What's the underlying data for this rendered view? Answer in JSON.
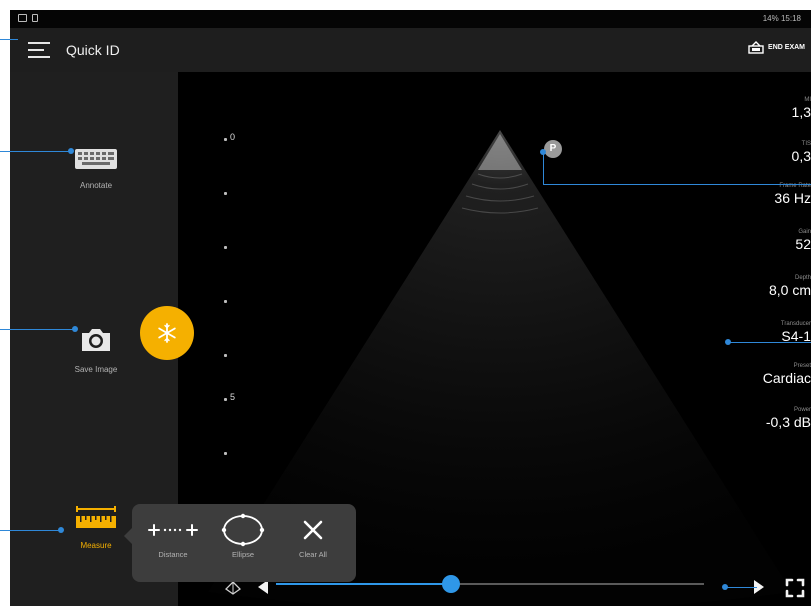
{
  "status_bar": {
    "right_text": "14% 15:18"
  },
  "app_bar": {
    "title": "Quick ID",
    "end_exam_label": "END EXAM"
  },
  "sidebar": {
    "annotate_label": "Annotate",
    "save_image_label": "Save Image",
    "measure_label": "Measure"
  },
  "depth_scale": {
    "top_label": "0",
    "mid_label": "5"
  },
  "marker": {
    "orientation_label": "P"
  },
  "parameters": [
    {
      "key": "MI",
      "value": "1,3"
    },
    {
      "key": "TIS",
      "value": "0,3"
    },
    {
      "key": "Frame Rate",
      "value": "36 Hz"
    },
    {
      "key": "Gain",
      "value": "52"
    },
    {
      "key": "Depth",
      "value": "8,0 cm"
    },
    {
      "key": "Transducer",
      "value": "S4-1"
    },
    {
      "key": "Preset",
      "value": "Cardiac"
    },
    {
      "key": "Power",
      "value": "-0,3 dB"
    }
  ],
  "measure_popup": {
    "distance_label": "Distance",
    "ellipse_label": "Ellipse",
    "clear_all_label": "Clear All"
  },
  "cine_slider": {
    "position": 0.41
  },
  "colors": {
    "accent": "#f5b000",
    "slider": "#2f97e8",
    "callout": "#2f88d8",
    "sidebar": "#1f1f1f",
    "app_bar": "#1e1e1e"
  }
}
